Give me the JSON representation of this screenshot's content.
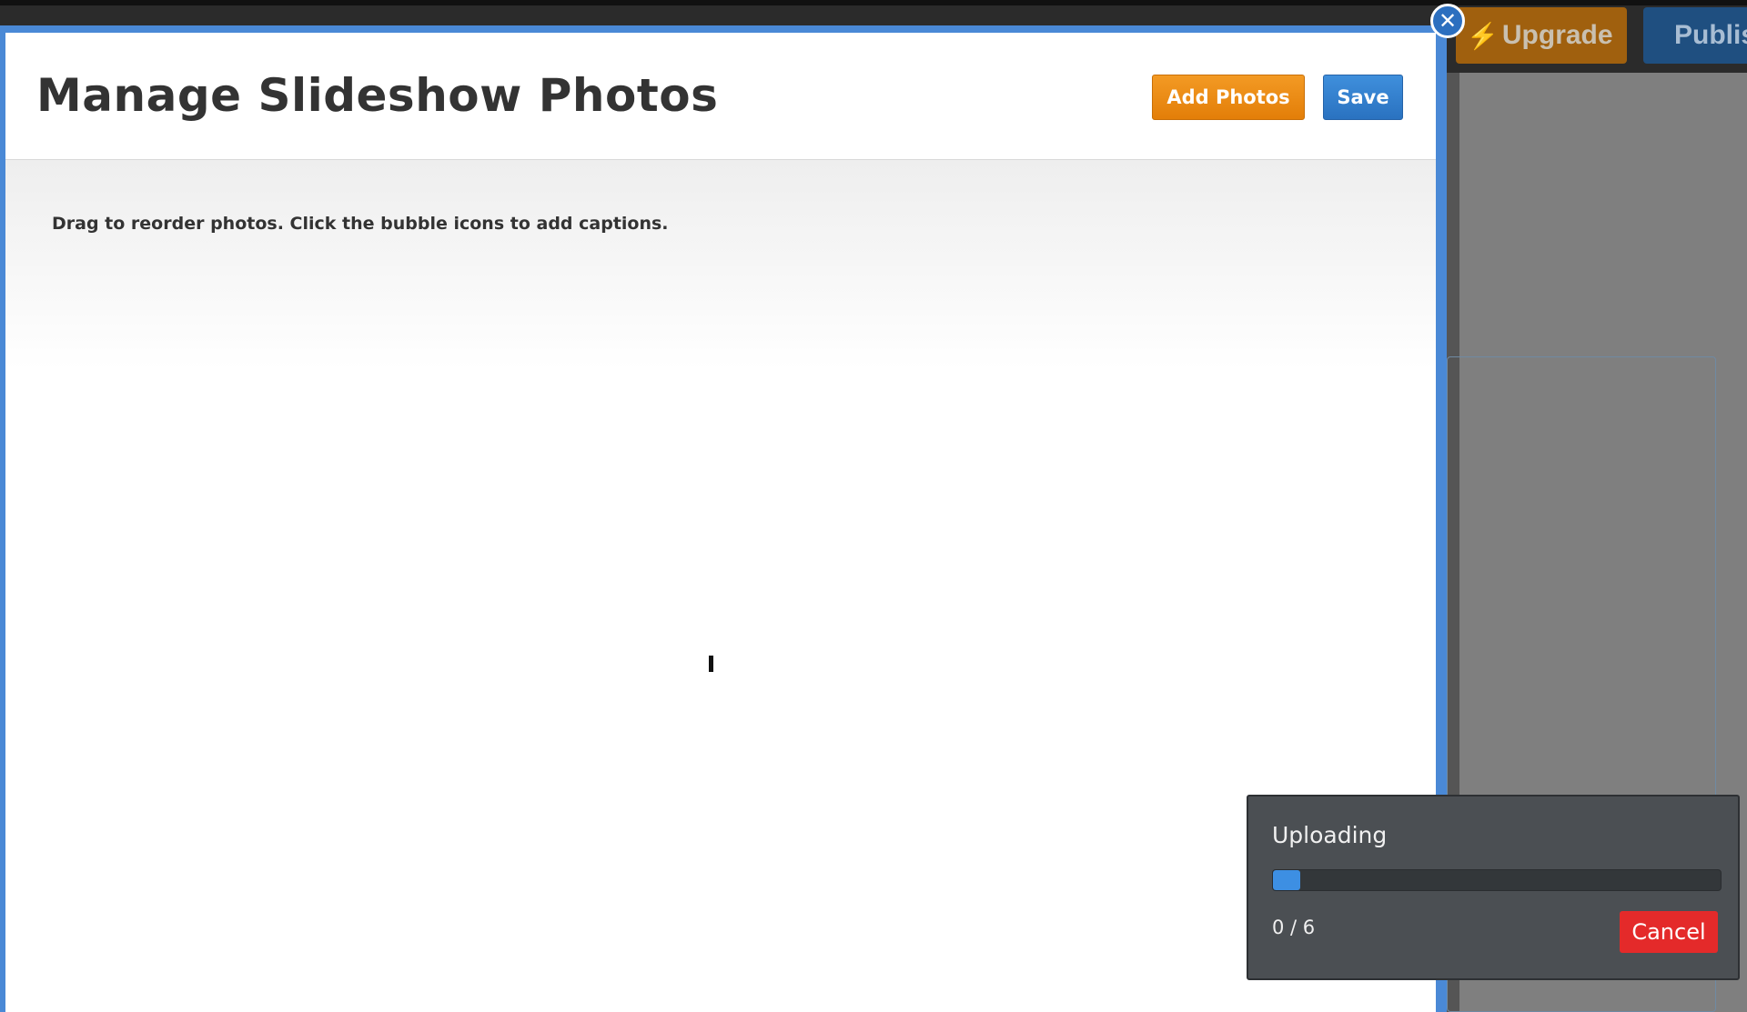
{
  "background": {
    "upgrade_label": "Upgrade",
    "upgrade_icon": "lightning-bolt-icon",
    "publish_label": "Publis"
  },
  "modal": {
    "title": "Manage Slideshow Photos",
    "add_photos_label": "Add Photos",
    "save_label": "Save",
    "instructions": "Drag to reorder photos. Click the bubble icons to add captions.",
    "close_icon": "close-icon"
  },
  "upload": {
    "title": "Uploading",
    "progress_fraction": 0.06,
    "count": "0 / 6",
    "cancel_label": "Cancel"
  },
  "colors": {
    "modal_border": "#4a89d6",
    "add_photos": "#e78a14",
    "save": "#3380d0",
    "cancel": "#e42a2a",
    "progress": "#3d8fe3"
  }
}
